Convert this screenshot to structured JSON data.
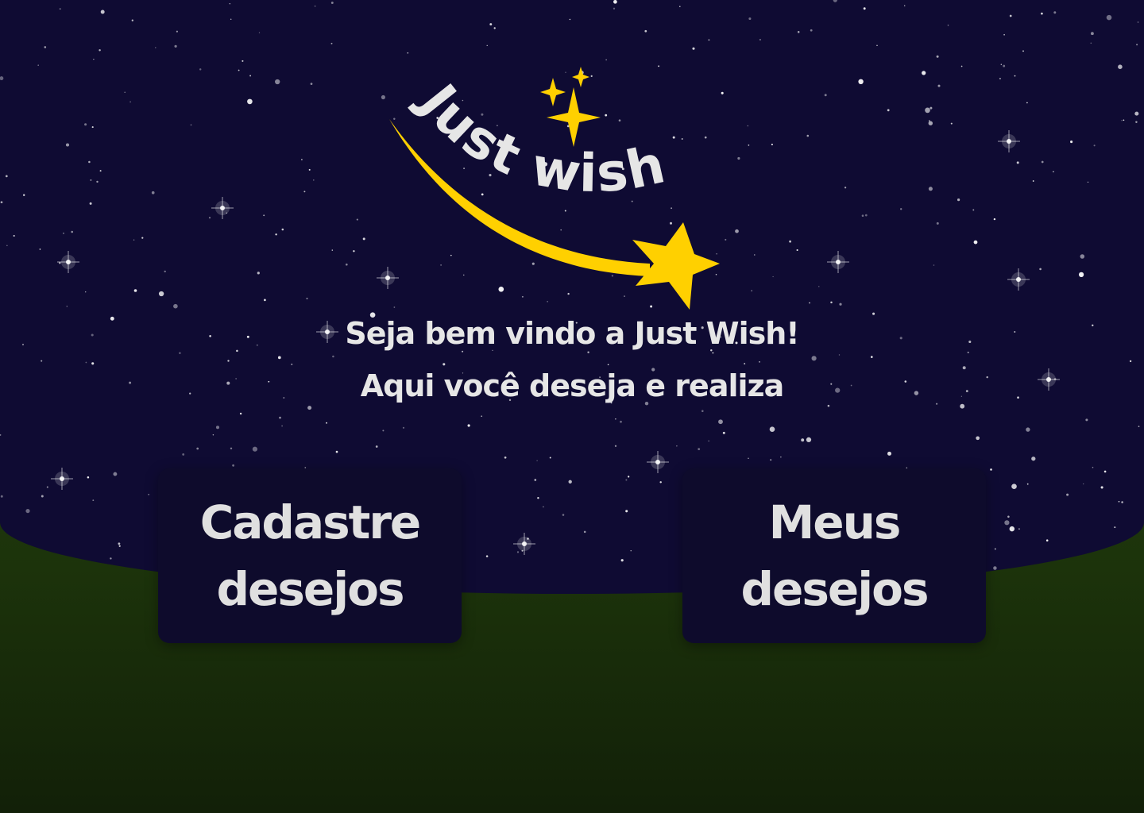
{
  "logo": {
    "text": "Just wish"
  },
  "welcome": {
    "line1": "Seja bem vindo a Just Wish!",
    "line2": "Aqui você deseja e realiza"
  },
  "actions": {
    "register_label": "Cadastre desejos",
    "mine_label": "Meus desejos"
  },
  "colors": {
    "sky": "#0f0b33",
    "ground": "#24400f",
    "accent": "#ffd000",
    "card": "#0e0b2c",
    "text": "#e6e6e6"
  }
}
